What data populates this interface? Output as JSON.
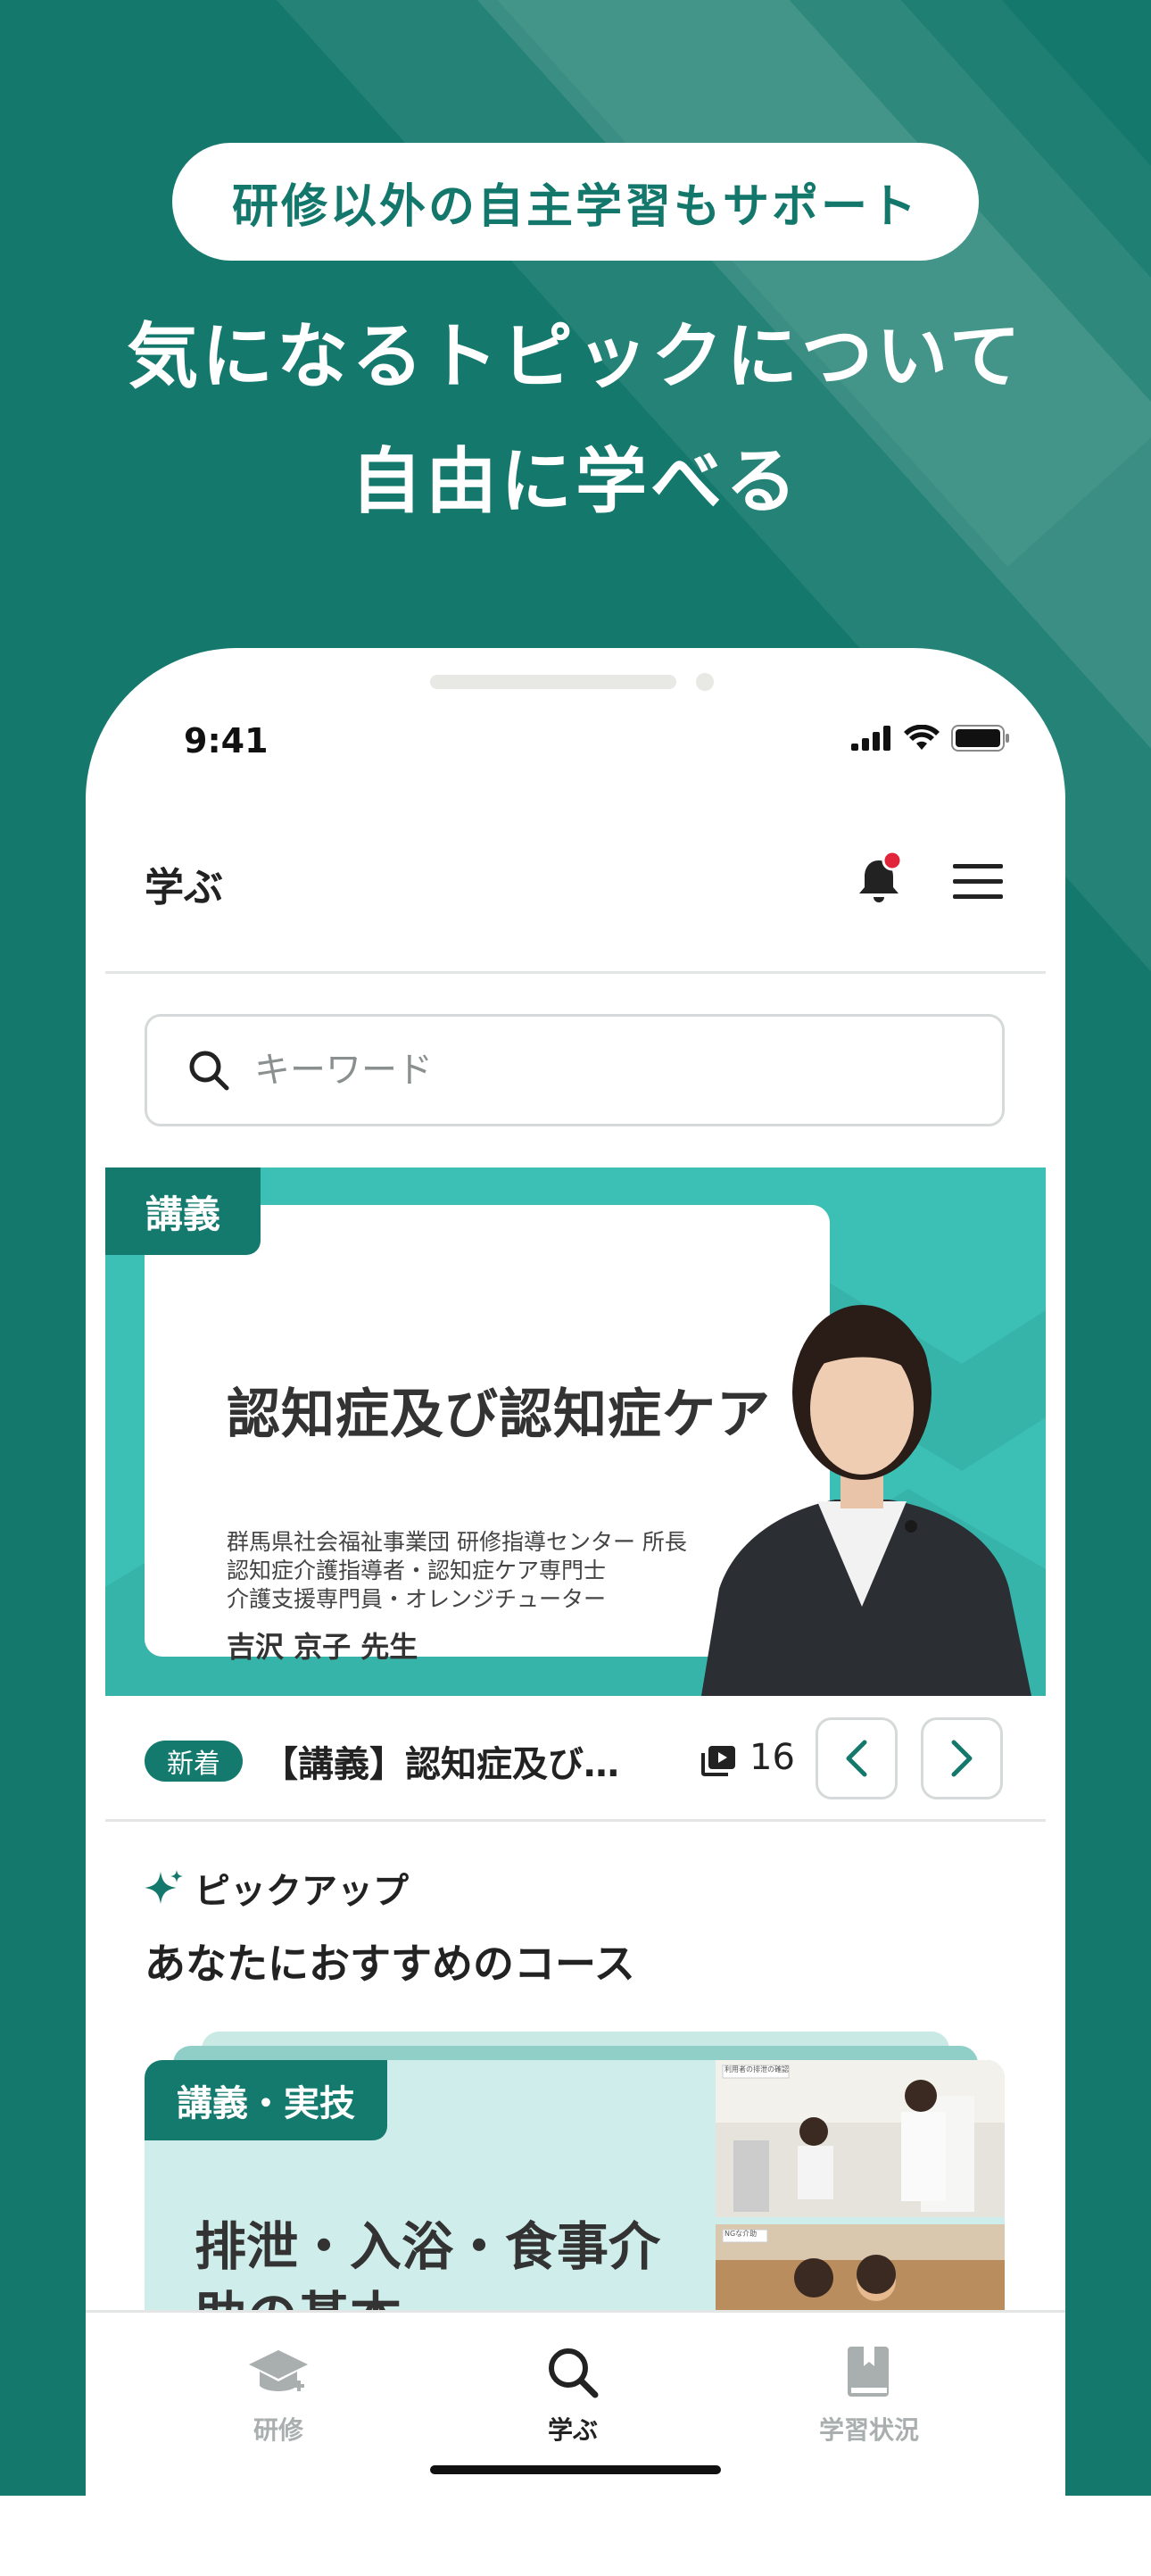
{
  "promo": {
    "pill_text": "研修以外の自主学習もサポート",
    "headline_line1": "気になるトピックについて",
    "headline_line2": "自由に学べる"
  },
  "status_bar": {
    "time": "9:41"
  },
  "header": {
    "title": "学ぶ",
    "notification_dot_color": "#e0243a"
  },
  "search": {
    "placeholder": "キーワード"
  },
  "banner": {
    "tag": "講義",
    "title": "認知症及び認知症ケア",
    "description_lines": [
      "群馬県社会福祉事業団 研修指導センター 所長",
      "認知症介護指導者・認知症ケア専門士",
      "介護支援専門員・オレンジチューター"
    ],
    "lecturer": "吉沢 京子 先生"
  },
  "carousel_info": {
    "badge": "新着",
    "title": "【講義】認知症及び…",
    "count": "16"
  },
  "pickup": {
    "label": "ピックアップ",
    "section_title": "あなたにおすすめのコース"
  },
  "course_card": {
    "tag": "講義・実技",
    "title": "排泄・入浴・食事介助の基本",
    "thumb1_caption": "利用者の排泄の確認",
    "thumb2_caption": "NGな介助"
  },
  "tabs": [
    {
      "label": "研修",
      "icon": "graduation-cap-icon",
      "active": false
    },
    {
      "label": "学ぶ",
      "icon": "search-icon",
      "active": true
    },
    {
      "label": "学習状況",
      "icon": "book-icon",
      "active": false
    }
  ],
  "colors": {
    "brand": "#14796c",
    "accent": "#157a6e",
    "banner_bg": "#3cbfb4",
    "tab_inactive": "#a9aeae",
    "tab_active": "#222222"
  }
}
